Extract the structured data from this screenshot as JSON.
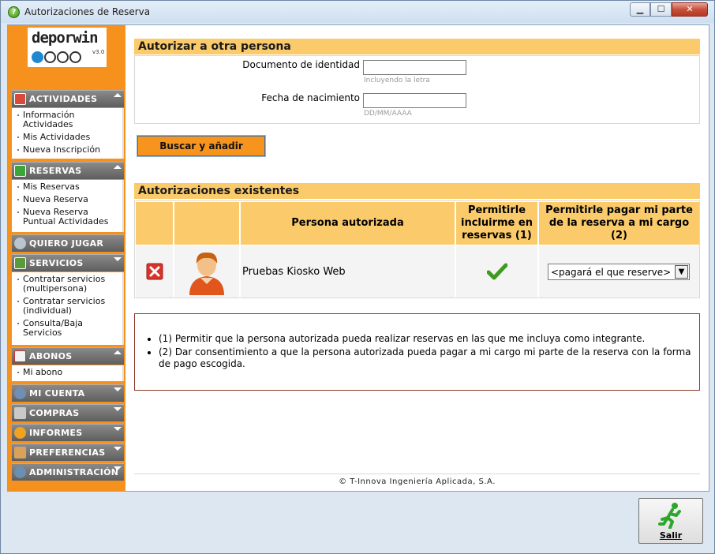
{
  "window": {
    "title": "Autorizaciones de Reserva",
    "min_symbol": "▁",
    "max_symbol": "☐",
    "close_symbol": "✕"
  },
  "logo": {
    "name": "deporwin",
    "version": "v3.0"
  },
  "sidebar": {
    "sections": [
      {
        "label": "ACTIVIDADES",
        "icon": "calendar-icon",
        "items": [
          "Información Actividades",
          "Mis Actividades",
          "Nueva Inscripción"
        ]
      },
      {
        "label": "RESERVAS",
        "icon": "court-icon",
        "items": [
          "Mis Reservas",
          "Nueva Reserva",
          "Nueva Reserva Puntual Actividades"
        ]
      },
      {
        "label": "QUIERO JUGAR",
        "icon": "racket-icon",
        "items": []
      },
      {
        "label": "SERVICIOS",
        "icon": "document-icon",
        "items": [
          "Contratar servicios (multipersona)",
          "Contratar servicios (individual)",
          "Consulta/Baja Servicios"
        ]
      },
      {
        "label": "ABONOS",
        "icon": "card-icon",
        "items": [
          "Mi abono"
        ]
      },
      {
        "label": "MI CUENTA",
        "icon": "users-icon",
        "items": []
      },
      {
        "label": "COMPRAS",
        "icon": "cart-icon",
        "items": []
      },
      {
        "label": "INFORMES",
        "icon": "chart-icon",
        "items": []
      },
      {
        "label": "PREFERENCIAS",
        "icon": "tools-icon",
        "items": []
      },
      {
        "label": "ADMINISTRACIÓN",
        "icon": "admin-icon",
        "items": []
      }
    ]
  },
  "authorize": {
    "title": "Autorizar a otra persona",
    "doc_label": "Documento de identidad",
    "doc_value": "",
    "doc_hint": "Incluyendo la letra",
    "birth_label": "Fecha de nacimiento",
    "birth_value": "",
    "birth_hint": "DD/MM/AAAA",
    "search_button": "Buscar y añadir"
  },
  "existing": {
    "title": "Autorizaciones existentes",
    "headers": {
      "person": "Persona autorizada",
      "include": "Permitirle incluirme en reservas (1)",
      "pay": "Permitirle pagar mi parte de la reserva a mi cargo (2)"
    },
    "rows": [
      {
        "person": "Pruebas Kiosko Web",
        "include_allowed": true,
        "pay_option": "<pagará el que reserve>"
      }
    ]
  },
  "notes": [
    "(1) Permitir que la persona autorizada pueda realizar reservas en las que me incluya como integrante.",
    "(2) Dar consentimiento a que la persona autorizada pueda pagar a mi cargo mi parte de la reserva con la forma de pago escogida."
  ],
  "footer": "© T-Innova Ingeniería Aplicada, S.A.",
  "exit_button": "Salir",
  "colors": {
    "accent": "#f6911e",
    "header": "#fbcb6b",
    "nav": "#6e6e6e",
    "check": "#3f9a1e",
    "delete": "#d9342b"
  }
}
